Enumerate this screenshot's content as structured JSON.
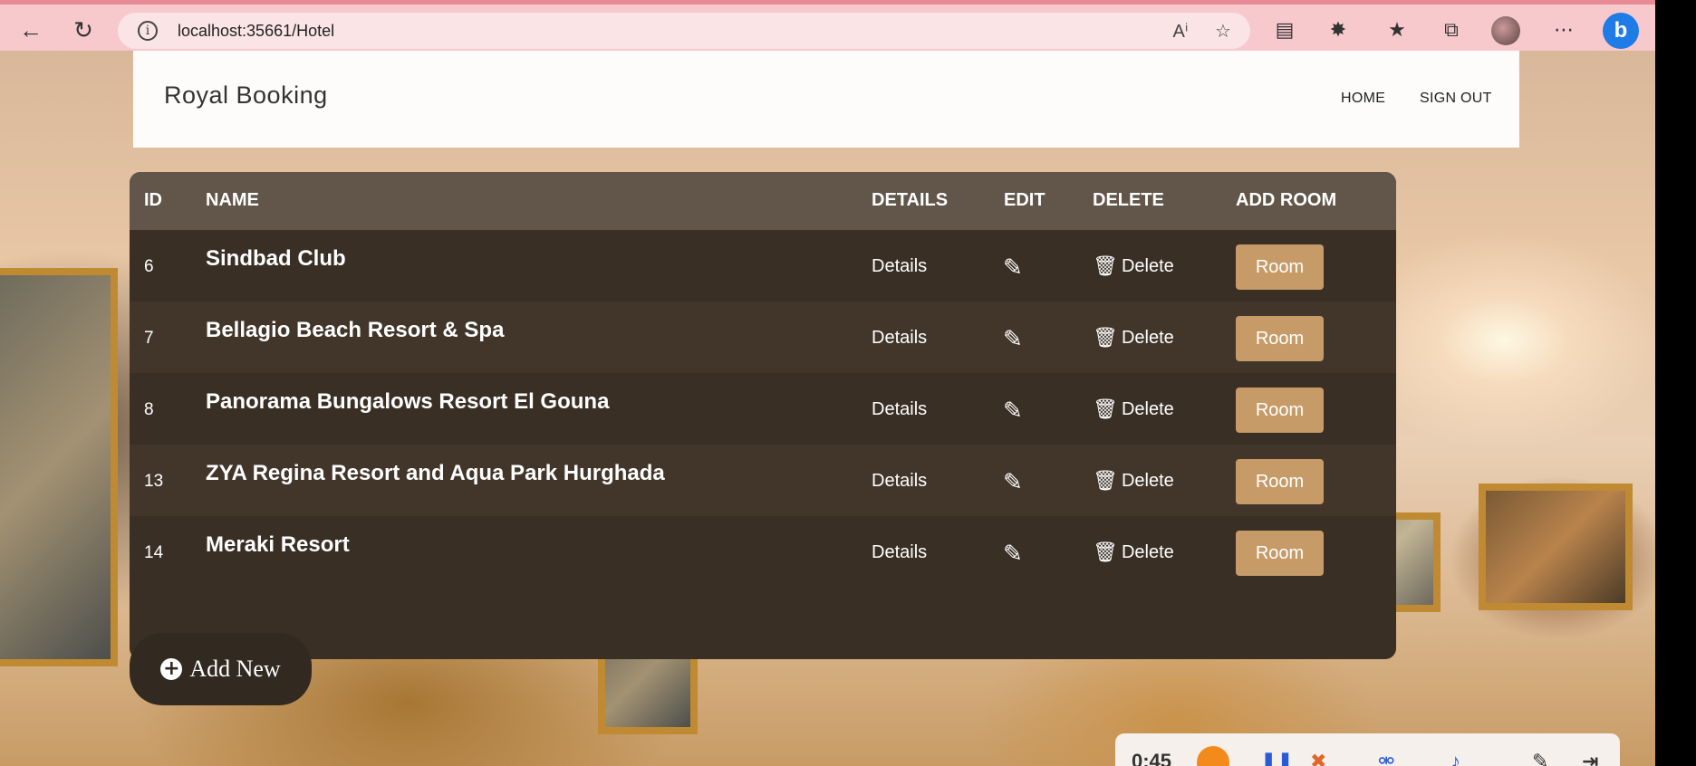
{
  "browser": {
    "url": "localhost:35661/Hotel"
  },
  "navbar": {
    "brand": "Royal Booking",
    "links": [
      "HOME",
      "SIGN OUT"
    ]
  },
  "table": {
    "headers": [
      "ID",
      "NAME",
      "DETAILS",
      "EDIT",
      "DELETE",
      "ADD ROOM"
    ],
    "rows": [
      {
        "id": "6",
        "name": "Sindbad Club",
        "details": "Details",
        "delete": "Delete",
        "room": "Room"
      },
      {
        "id": "7",
        "name": "Bellagio Beach Resort & Spa",
        "details": "Details",
        "delete": "Delete",
        "room": "Room"
      },
      {
        "id": "8",
        "name": "Panorama Bungalows Resort El Gouna",
        "details": "Details",
        "delete": "Delete",
        "room": "Room"
      },
      {
        "id": "13",
        "name": "ZYA Regina Resort and Aqua Park Hurghada",
        "details": "Details",
        "delete": "Delete",
        "room": "Room"
      },
      {
        "id": "14",
        "name": "Meraki Resort",
        "details": "Details",
        "delete": "Delete",
        "room": "Room"
      }
    ]
  },
  "add_new": {
    "label": "Add New"
  },
  "recorder": {
    "time": "0:45"
  },
  "colors": {
    "table_bg": "#3a2f25",
    "table_header_bg": "#62564a",
    "room_button": "#c79b68",
    "browser_bar": "#f7c9cd"
  }
}
